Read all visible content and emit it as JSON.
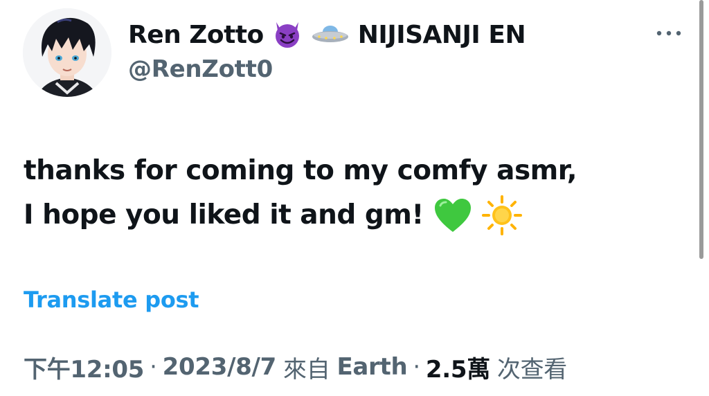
{
  "author": {
    "display_name": "Ren Zotto",
    "name_emoji_1": "smiling-devil-emoji",
    "name_emoji_2": "ufo-emoji",
    "name_suffix": "NIJISANJI EN",
    "handle": "@RenZott0"
  },
  "tweet": {
    "line_1": "thanks for coming to my comfy asmr,",
    "line_2": "I hope you liked it and gm!",
    "emojis": [
      "green-heart-emoji",
      "sun-emoji"
    ]
  },
  "actions": {
    "translate_label": "Translate post",
    "more_icon": "more-horizontal-icon"
  },
  "meta": {
    "time": "下午12:05",
    "separator": "·",
    "date": "2023/8/7",
    "source_prefix": "來自",
    "source": "Earth",
    "views_count": "2.5萬",
    "views_label": "次查看"
  },
  "colors": {
    "text_primary": "#0f1419",
    "text_secondary": "#536471",
    "link": "#1d9bf0",
    "green_heart": "#3fc83f",
    "sun": "#ffb300",
    "devil_purple": "#8a3fc4"
  }
}
